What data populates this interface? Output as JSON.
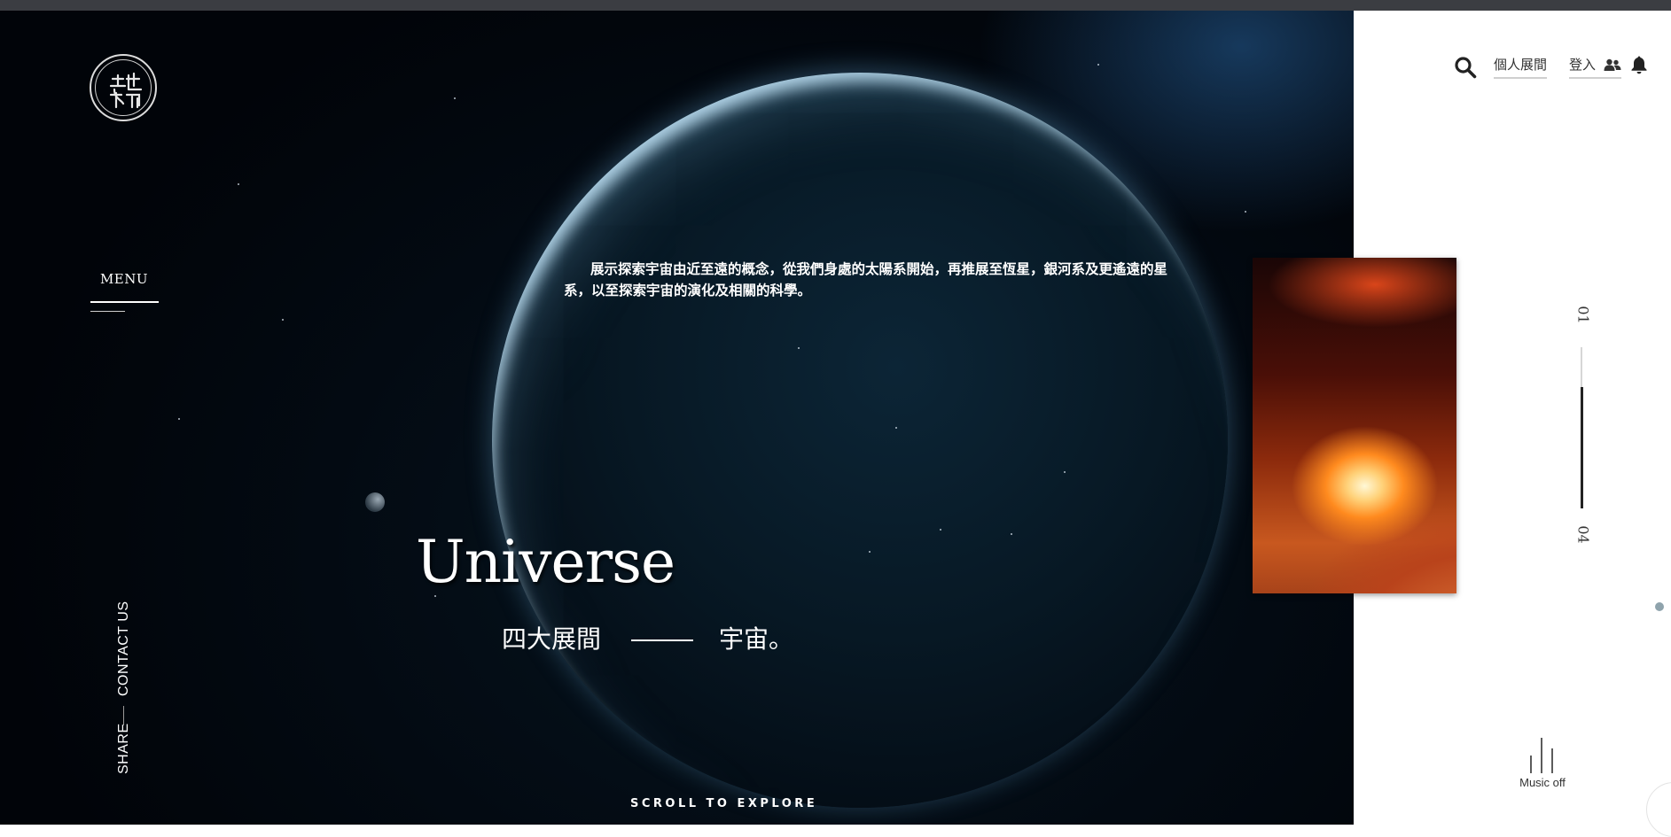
{
  "header": {
    "logo": "logo-icon",
    "nav": {
      "search_icon": "search-icon",
      "exhibition_label": "個人展間",
      "login_label": "登入",
      "login_icon": "users-icon",
      "notification_icon": "bell-icon"
    }
  },
  "sidebar": {
    "menu_label": "MENU",
    "contact_label": "CONTACT US",
    "share_label": "SHARE"
  },
  "hero": {
    "description": "展示探索宇宙由近至遠的概念，從我們身處的太陽系開始，再推展至恆星，銀河系及更遙遠的星系，以至探索宇宙的演化及相關的科學。",
    "title": "Universe",
    "subtitle_left": "四大展間",
    "subtitle_right": "宇宙。",
    "scroll_label": "SCROLL TO EXPLORE"
  },
  "pager": {
    "current": "01",
    "total": "04",
    "progress": 0.75
  },
  "music": {
    "icon": "music-bars-icon",
    "label": "Music off"
  },
  "colors": {
    "hero_bg": "#030a12",
    "panel_bg": "#ffffff",
    "text_light": "#ffffff",
    "text_dark": "#333333"
  }
}
